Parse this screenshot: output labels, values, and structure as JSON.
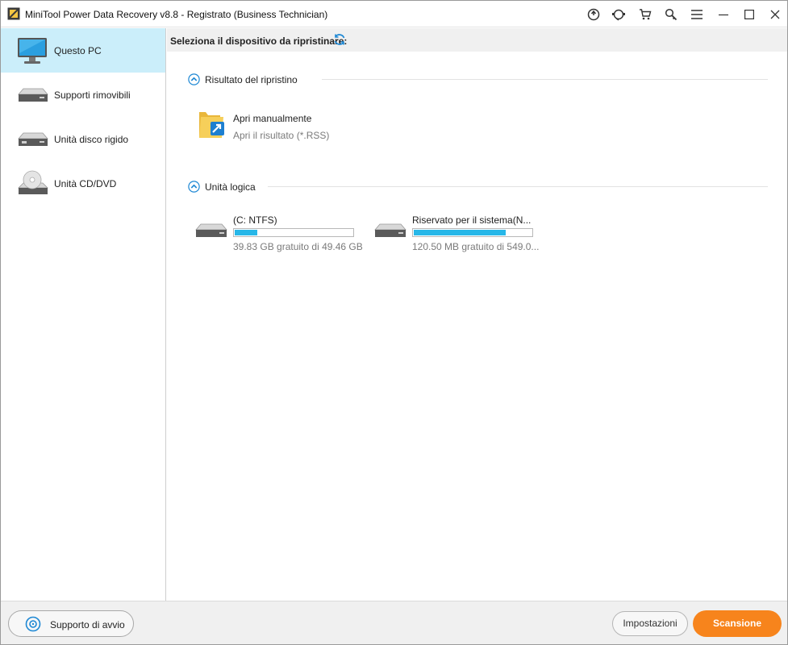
{
  "window": {
    "title": "MiniTool Power Data Recovery v8.8 - Registrato (Business Technician)",
    "titlebar_icons": [
      "upgrade-icon",
      "support-icon",
      "cart-icon",
      "search-key-icon",
      "menu-icon",
      "minimize-icon",
      "maximize-icon",
      "close-icon"
    ]
  },
  "sidebar": {
    "items": [
      {
        "label": "Questo PC",
        "icon": "monitor-icon",
        "active": true
      },
      {
        "label": "Supporti rimovibili",
        "icon": "removable-drive-icon",
        "active": false
      },
      {
        "label": "Unità disco rigido",
        "icon": "hard-disk-icon",
        "active": false
      },
      {
        "label": "Unità CD/DVD",
        "icon": "cd-dvd-icon",
        "active": false
      }
    ]
  },
  "main": {
    "header": "Seleziona il dispositivo da ripristinare:",
    "sections": {
      "recovery_result": {
        "title": "Risultato del ripristino",
        "item": {
          "title": "Apri manualmente",
          "subtitle": "Apri il risultato (*.RSS)"
        }
      },
      "logical_drives": {
        "title": "Unità logica",
        "drives": [
          {
            "name": "(C: NTFS)",
            "info": "39.83 GB gratuito di 49.46 GB",
            "used_fraction": 0.19
          },
          {
            "name": "Riservato per il sistema(N...",
            "info": "120.50 MB gratuito di 549.0...",
            "used_fraction": 0.78
          }
        ]
      }
    }
  },
  "footer": {
    "boot_label": "Supporto di avvio",
    "settings_label": "Impostazioni",
    "scan_label": "Scansione"
  },
  "colors": {
    "accent_orange": "#f7841c",
    "sidebar_active": "#cbeefa",
    "bar_fill": "#27b7e8",
    "header_bg": "#f0f0f0"
  }
}
